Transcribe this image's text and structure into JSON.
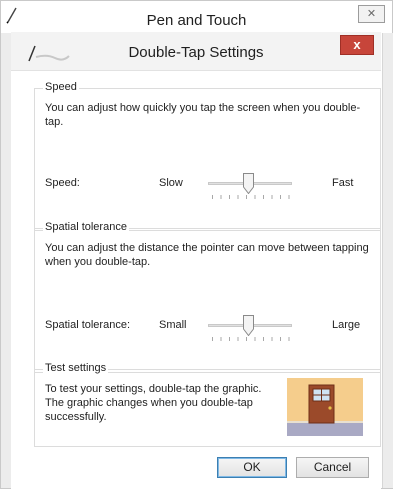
{
  "outer_window": {
    "title": "Pen and Touch",
    "close_glyph": "✕"
  },
  "dialog": {
    "title": "Double-Tap Settings",
    "close_glyph": "x"
  },
  "speed_group": {
    "title": "Speed",
    "description": "You can adjust how quickly you tap the screen when you double-tap.",
    "row_label": "Speed:",
    "min_label": "Slow",
    "max_label": "Fast",
    "slider_value": 0.45
  },
  "tolerance_group": {
    "title": "Spatial tolerance",
    "description": "You can adjust the distance the pointer can move between tapping when you double-tap.",
    "row_label": "Spatial tolerance:",
    "min_label": "Small",
    "max_label": "Large",
    "slider_value": 0.45
  },
  "test_group": {
    "title": "Test settings",
    "description": "To test your settings, double-tap the graphic. The graphic changes when you double-tap successfully."
  },
  "buttons": {
    "ok": "OK",
    "cancel": "Cancel"
  },
  "icons": {
    "outer": "pen-icon",
    "dialog": "pen-icon",
    "test": "door-graphic"
  }
}
